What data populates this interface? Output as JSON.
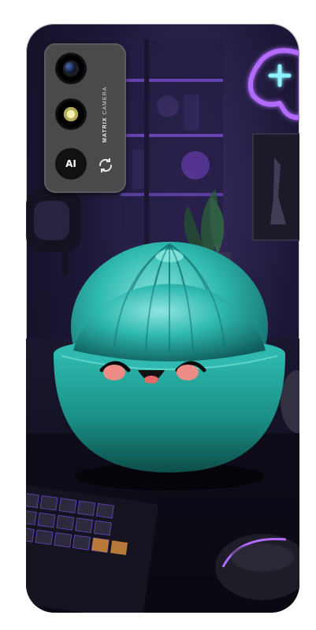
{
  "camera": {
    "brand": "MATRIX",
    "model": "CAMERA",
    "ai_label": "AI"
  },
  "icons": [
    "sync-icon",
    "gamepad-neon-icon",
    "smile-face"
  ],
  "colors": {
    "case_body": "#1d1838",
    "neon_purple": "#b36bff",
    "neon_cyan": "#8ef3ff",
    "mascot_teal": "#2fb9b0",
    "bowl_teal": "#1a8f86",
    "camera_module": "#4a4a4c"
  }
}
